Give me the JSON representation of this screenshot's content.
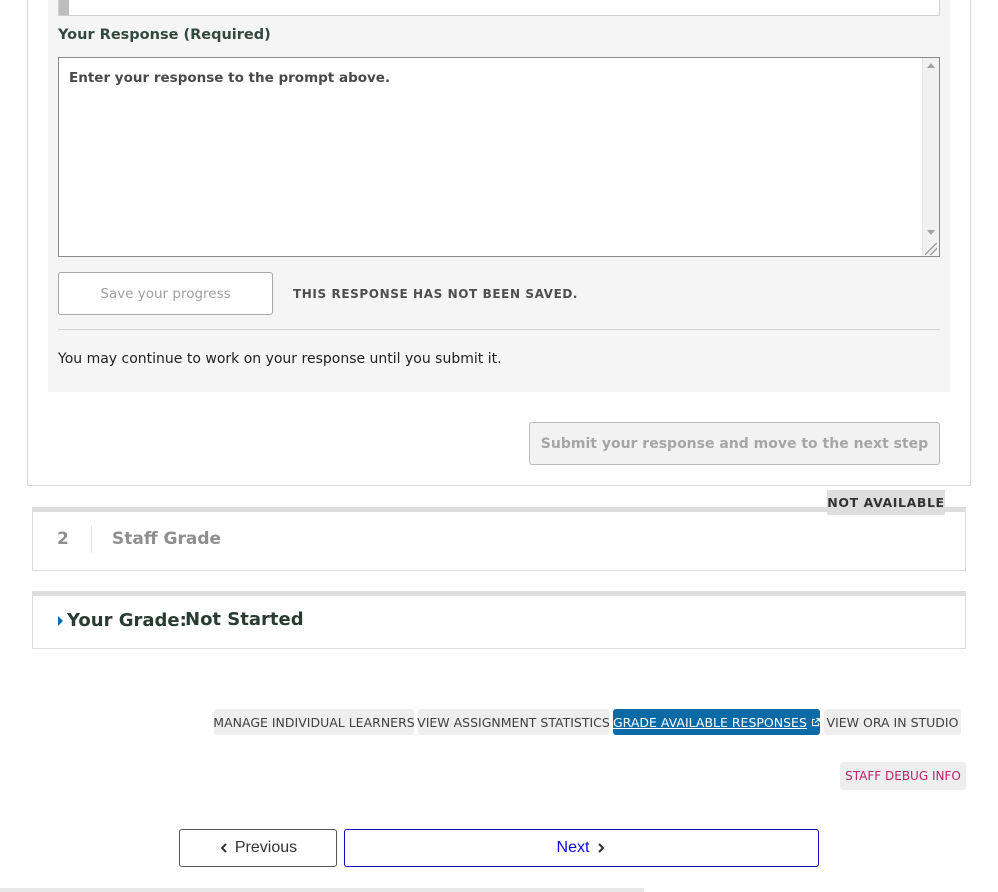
{
  "response": {
    "label": "Your Response (Required)",
    "placeholder": "Enter your response to the prompt above.",
    "value": "",
    "save_label": "Save your progress",
    "save_status": "THIS RESPONSE HAS NOT BEEN SAVED.",
    "continue_note": "You may continue to work on your response until you submit it.",
    "submit_label": "Submit your response and move to the next step"
  },
  "staff_grade_step": {
    "status_badge": "NOT AVAILABLE",
    "number": "2",
    "title": "Staff Grade"
  },
  "your_grade": {
    "label": "Your Grade:",
    "value": "Not Started"
  },
  "staff_tools": {
    "manage_learners": "MANAGE INDIVIDUAL LEARNERS",
    "view_statistics": "VIEW ASSIGNMENT STATISTICS",
    "grade_responses": "GRADE AVAILABLE RESPONSES",
    "view_in_studio": "VIEW ORA IN STUDIO",
    "debug_info": "STAFF DEBUG INFO"
  },
  "navigation": {
    "previous": "Previous",
    "next": "Next"
  },
  "colors": {
    "primary": "#0a6aa6",
    "debug_text": "#b5266a",
    "next_border": "#1010c8"
  }
}
